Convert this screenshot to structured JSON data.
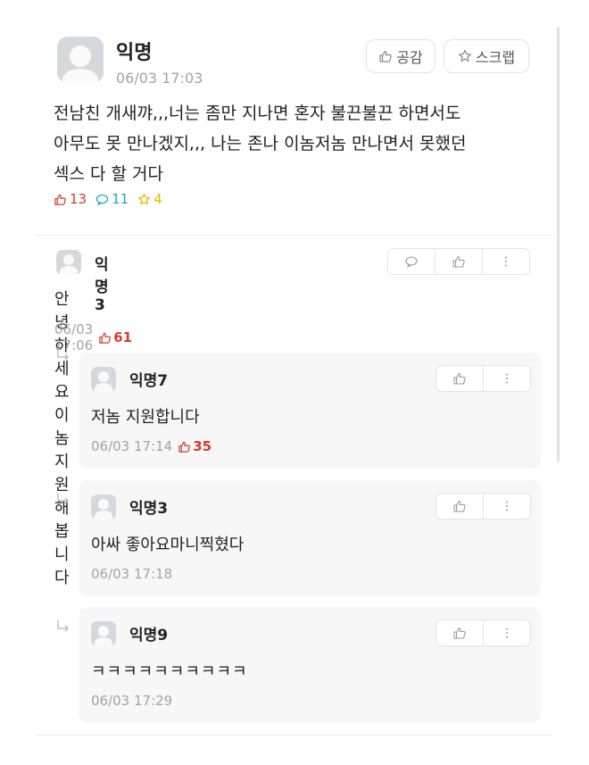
{
  "post": {
    "author": "익명",
    "date": "06/03 17:03",
    "like_label": "공감",
    "scrap_label": "스크랩",
    "body": "전남친 개새꺄,,,너는 좀만 지나면 혼자 불끈불끈 하면서도\n아무도 못 만나겠지,,, 나는 존나 이놈저놈 만나면서 못했던\n섹스 다 할 거다",
    "likes": "13",
    "comments": "11",
    "scraps": "4"
  },
  "comments": [
    {
      "author": "익명3",
      "body": "안녕하세요 이놈 지원해봅니다",
      "date": "06/03 17:06",
      "likes": "61"
    }
  ],
  "replies": [
    {
      "author": "익명7",
      "body": "저놈 지원합니다",
      "date": "06/03 17:14",
      "likes": "35"
    },
    {
      "author": "익명3",
      "body": "아싸 좋아요마니찍혔다",
      "date": "06/03 17:18",
      "likes": ""
    },
    {
      "author": "익명9",
      "body": "ㅋㅋㅋㅋㅋㅋㅋㅋㅋㅋ",
      "date": "06/03 17:29",
      "likes": ""
    }
  ],
  "icons": {
    "like": "thumbs-up-icon",
    "comment": "speech-bubble-icon",
    "scrap": "star-icon",
    "more": "more-vertical-icon",
    "reply": "reply-arrow-icon"
  },
  "colors": {
    "like": "#d63c2c",
    "comment": "#1ba8c6",
    "scrap": "#f1b400",
    "muted": "#a3a3a3"
  }
}
